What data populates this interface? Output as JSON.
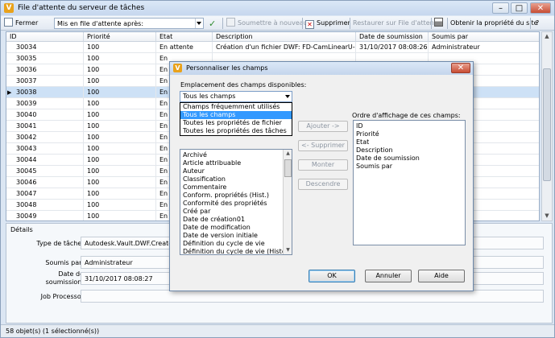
{
  "window": {
    "title": "File d'attente du serveur de tâches"
  },
  "toolbar": {
    "close_label": "Fermer",
    "put_after_label": "Mis en file d'attente après:",
    "put_after_value": "",
    "resubmit_label": "Soumettre à nouveau",
    "delete_label": "Supprimer",
    "restore_label": "Restaurer sur File d'attente",
    "take_ownership_label": "Obtenir la propriété du site",
    "help_label": "?"
  },
  "grid": {
    "columns": [
      "ID",
      "Priorité",
      "Etat",
      "Description",
      "Date de soumission",
      "Soumis par"
    ],
    "rows": [
      {
        "id": "30034",
        "priority": "100",
        "state": "En attente",
        "description": "Création d'un fichier DWF: FD-CamLinearU-in.ipt",
        "date": "31/10/2017 08:08:26",
        "by": "Administrateur",
        "selected": false,
        "marker": ""
      },
      {
        "id": "30035",
        "priority": "100",
        "state": "En",
        "description": "",
        "date": "",
        "by": "",
        "selected": false,
        "marker": ""
      },
      {
        "id": "30036",
        "priority": "100",
        "state": "En",
        "description": "",
        "date": "",
        "by": "",
        "selected": false,
        "marker": ""
      },
      {
        "id": "30037",
        "priority": "100",
        "state": "En",
        "description": "",
        "date": "",
        "by": "",
        "selected": false,
        "marker": ""
      },
      {
        "id": "30038",
        "priority": "100",
        "state": "En",
        "description": "",
        "date": "",
        "by": "",
        "selected": true,
        "marker": "▶"
      },
      {
        "id": "30039",
        "priority": "100",
        "state": "En",
        "description": "",
        "date": "",
        "by": "",
        "selected": false,
        "marker": ""
      },
      {
        "id": "30040",
        "priority": "100",
        "state": "En",
        "description": "",
        "date": "",
        "by": "",
        "selected": false,
        "marker": ""
      },
      {
        "id": "30041",
        "priority": "100",
        "state": "En",
        "description": "",
        "date": "",
        "by": "",
        "selected": false,
        "marker": ""
      },
      {
        "id": "30042",
        "priority": "100",
        "state": "En",
        "description": "",
        "date": "",
        "by": "",
        "selected": false,
        "marker": ""
      },
      {
        "id": "30043",
        "priority": "100",
        "state": "En",
        "description": "",
        "date": "",
        "by": "",
        "selected": false,
        "marker": ""
      },
      {
        "id": "30044",
        "priority": "100",
        "state": "En",
        "description": "",
        "date": "",
        "by": "",
        "selected": false,
        "marker": ""
      },
      {
        "id": "30045",
        "priority": "100",
        "state": "En",
        "description": "",
        "date": "",
        "by": "",
        "selected": false,
        "marker": ""
      },
      {
        "id": "30046",
        "priority": "100",
        "state": "En",
        "description": "",
        "date": "",
        "by": "",
        "selected": false,
        "marker": ""
      },
      {
        "id": "30047",
        "priority": "100",
        "state": "En",
        "description": "",
        "date": "",
        "by": "",
        "selected": false,
        "marker": ""
      },
      {
        "id": "30048",
        "priority": "100",
        "state": "En",
        "description": "",
        "date": "",
        "by": "",
        "selected": false,
        "marker": ""
      },
      {
        "id": "30049",
        "priority": "100",
        "state": "En",
        "description": "",
        "date": "",
        "by": "",
        "selected": false,
        "marker": ""
      }
    ]
  },
  "details": {
    "title": "Détails",
    "task_type_label": "Type de tâche:",
    "task_type_value": "Autodesk.Vault.DWF.Create.ipt",
    "submitted_by_label": "Soumis par:",
    "submitted_by_value": "Administrateur",
    "submit_date_label": "Date de soumission:",
    "submit_date_value": "31/10/2017 08:08:27",
    "job_processor_label": "Job Processor",
    "job_processor_value": ""
  },
  "status": {
    "text": "58 objet(s) (1 sélectionné(s))"
  },
  "dialog": {
    "title": "Personnaliser les champs",
    "location_label": "Emplacement des champs disponibles:",
    "location_value": "Tous les champs",
    "location_options": [
      {
        "label": "Champs fréquemment utilisés",
        "selected": false
      },
      {
        "label": "Tous les champs",
        "selected": true
      },
      {
        "label": "Toutes les propriétés de fichier",
        "selected": false
      },
      {
        "label": "Toutes les propriétés des tâches",
        "selected": false
      }
    ],
    "available_fields": [
      "Archivé",
      "Article attribuable",
      "Auteur",
      "Classification",
      "Commentaire",
      "Conform. propriétés (Hist.)",
      "Conformité des propriétés",
      "Créé par",
      "Date de création01",
      "Date de modification",
      "Date de version initiale",
      "Définition du cycle de vie",
      "Définition du cycle de vie (Historique"
    ],
    "order_label": "Ordre d'affichage de ces champs:",
    "order_fields": [
      "ID",
      "Priorité",
      "Etat",
      "Description",
      "Date de soumission",
      "Soumis par"
    ],
    "add_label": "Ajouter ->",
    "remove_label": "<- Supprimer",
    "up_label": "Monter",
    "down_label": "Descendre",
    "ok_label": "OK",
    "cancel_label": "Annuler",
    "help_label": "Aide"
  }
}
